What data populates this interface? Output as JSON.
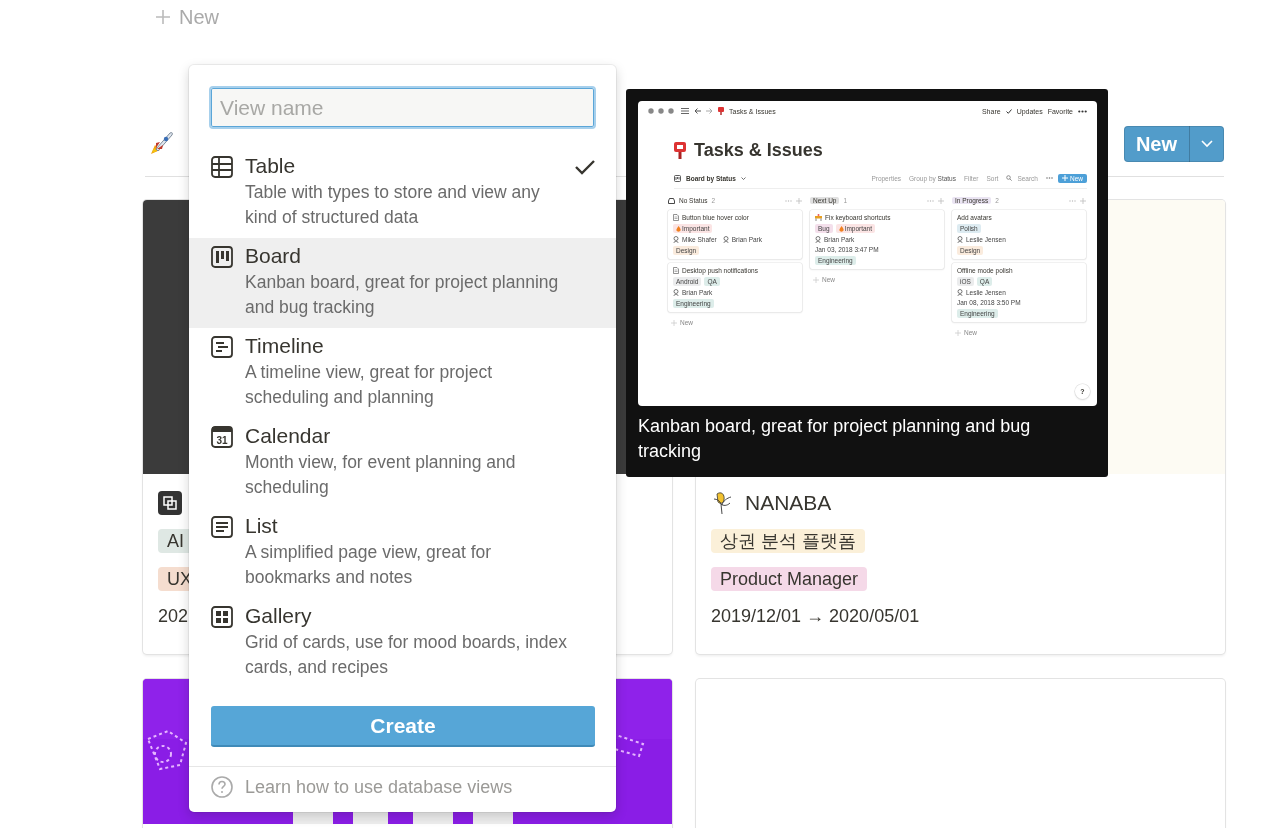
{
  "top_new": {
    "label": "New"
  },
  "header": {
    "new_button": "New"
  },
  "gallery": [
    {
      "kind": "dark",
      "tags": [
        {
          "label": "AI",
          "color": "#dfe8e4"
        },
        {
          "label": "UX",
          "color": "#f5ddcf"
        }
      ],
      "date": "202"
    },
    {
      "kind": "cream",
      "title": "NANABA",
      "tags": [
        {
          "label": "상권 분석 플랫폼",
          "color": "#fbf0d9"
        },
        {
          "label": "Product Manager",
          "color": "#f5d9e8"
        }
      ],
      "date": "2019/12/01 → 2020/05/01"
    },
    {
      "kind": "picture"
    },
    {
      "kind": "blank"
    }
  ],
  "view_menu": {
    "placeholder": "View name",
    "options": [
      {
        "kind": "table",
        "title": "Table",
        "description": "Table with types to store and view any kind of structured data",
        "selected": true,
        "highlighted": false
      },
      {
        "kind": "board",
        "title": "Board",
        "description": "Kanban board, great for project planning and bug tracking",
        "selected": false,
        "highlighted": true
      },
      {
        "kind": "timeline",
        "title": "Timeline",
        "description": "A timeline view, great for project scheduling and planning",
        "selected": false,
        "highlighted": false
      },
      {
        "kind": "calendar",
        "title": "Calendar",
        "description": "Month view, for event planning and scheduling",
        "selected": false,
        "highlighted": false,
        "icon_text": "31"
      },
      {
        "kind": "list",
        "title": "List",
        "description": "A simplified page view, great for bookmarks and notes",
        "selected": false,
        "highlighted": false
      },
      {
        "kind": "gallery",
        "title": "Gallery",
        "description": "Grid of cards, use for mood boards, index cards, and recipes",
        "selected": false,
        "highlighted": false
      }
    ],
    "create_button": "Create",
    "help_link": "Learn how to use database views"
  },
  "preview": {
    "window_title": "Tasks & Issues",
    "window_actions": [
      "Share",
      "Updates",
      "Favorite"
    ],
    "page_title": "Tasks & Issues",
    "view_label": "Board by Status",
    "toolbar": [
      "Properties",
      "Group by **Status**",
      "Filter",
      "Sort",
      "Search"
    ],
    "new_button": "New",
    "columns": [
      {
        "name": "No Status",
        "count": "2",
        "cards": [
          {
            "kind": "document",
            "title": "Button blue hover color",
            "tags": [
              {
                "label": "Important",
                "color": "#fbe4e4",
                "flame": true
              }
            ],
            "people": [
              "Mike Shafer",
              "Brian Park"
            ],
            "labels": [
              {
                "label": "Design",
                "color": "#faebdd"
              }
            ]
          },
          {
            "kind": "document",
            "title": "Desktop push notifications",
            "tags": [
              {
                "label": "Android",
                "color": "#ebeced",
                "flame": false
              },
              {
                "label": "QA",
                "color": "#ddedea",
                "flame": false
              }
            ],
            "people": [
              "Brian Park"
            ],
            "labels": [
              {
                "label": "Engineering",
                "color": "#ddedea"
              }
            ]
          }
        ],
        "add": "New"
      },
      {
        "name": "Next Up",
        "count": "1",
        "color": "#e0e0e0",
        "cards": [
          {
            "kind": "barrier",
            "title": "Fix keyboard shortcuts",
            "tags": [
              {
                "label": "Bug",
                "color": "#f4dfeb",
                "flame": false
              },
              {
                "label": "Important",
                "color": "#fbe4e4",
                "flame": true
              }
            ],
            "people": [
              "Brian Park"
            ],
            "date": "Jan 03, 2018 3:47 PM",
            "labels": [
              {
                "label": "Engineering",
                "color": "#ddedea"
              }
            ]
          }
        ],
        "add": "New"
      },
      {
        "name": "In Progress",
        "count": "2",
        "color": "#eae4f2",
        "cards": [
          {
            "kind": "plain",
            "title": "Add avatars",
            "tags": [
              {
                "label": "Polish",
                "color": "#ddebf1",
                "flame": false
              }
            ],
            "people": [
              "Leslie Jensen"
            ],
            "labels": [
              {
                "label": "Design",
                "color": "#faebdd"
              }
            ]
          },
          {
            "kind": "plain",
            "title": "Offline mode polish",
            "tags": [
              {
                "label": "iOS",
                "color": "#ebeced",
                "flame": false
              },
              {
                "label": "QA",
                "color": "#ddedea",
                "flame": false
              }
            ],
            "people": [
              "Leslie Jensen"
            ],
            "date": "Jan 08, 2018 3:50 PM",
            "labels": [
              {
                "label": "Engineering",
                "color": "#ddedea"
              }
            ]
          }
        ],
        "add": "New"
      }
    ],
    "help": "?",
    "caption": "Kanban board, great for project planning and bug tracking"
  }
}
